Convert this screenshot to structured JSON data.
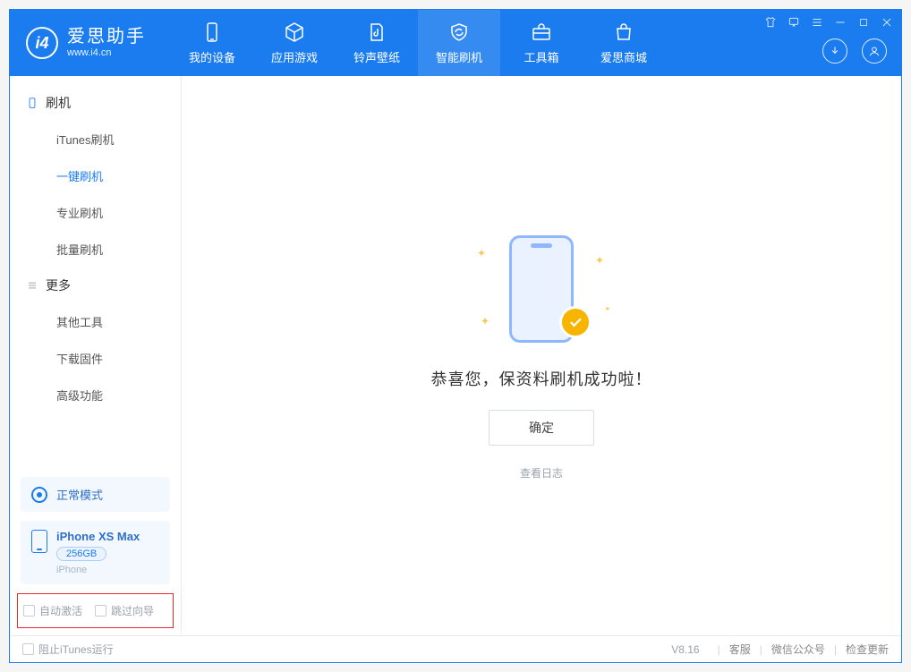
{
  "app": {
    "title": "爱思助手",
    "subtitle": "www.i4.cn"
  },
  "nav": {
    "items": [
      {
        "label": "我的设备"
      },
      {
        "label": "应用游戏"
      },
      {
        "label": "铃声壁纸"
      },
      {
        "label": "智能刷机"
      },
      {
        "label": "工具箱"
      },
      {
        "label": "爱思商城"
      }
    ]
  },
  "sidebar": {
    "group_flash": "刷机",
    "items_flash": [
      {
        "label": "iTunes刷机"
      },
      {
        "label": "一键刷机"
      },
      {
        "label": "专业刷机"
      },
      {
        "label": "批量刷机"
      }
    ],
    "group_more": "更多",
    "items_more": [
      {
        "label": "其他工具"
      },
      {
        "label": "下载固件"
      },
      {
        "label": "高级功能"
      }
    ],
    "status_mode": "正常模式",
    "device": {
      "name": "iPhone XS Max",
      "capacity": "256GB",
      "type": "iPhone"
    },
    "auto_activate": "自动激活",
    "skip_guide": "跳过向导"
  },
  "main": {
    "success_text": "恭喜您，保资料刷机成功啦！",
    "ok_label": "确定",
    "view_log": "查看日志"
  },
  "statusbar": {
    "block_itunes": "阻止iTunes运行",
    "version": "V8.16",
    "support": "客服",
    "wechat": "微信公众号",
    "check_update": "检查更新"
  }
}
